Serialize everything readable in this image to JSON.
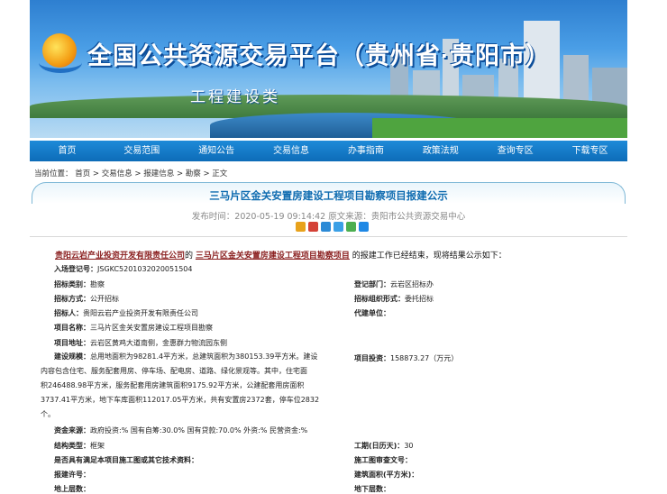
{
  "banner": {
    "title": "全国公共资源交易平台（贵州省·贵阳市）",
    "subtitle": "工程建设类"
  },
  "nav": [
    "首页",
    "交易范围",
    "通知公告",
    "交易信息",
    "办事指南",
    "政策法规",
    "查询专区",
    "下载专区"
  ],
  "breadcrumb": "当前位置： 首页 > 交易信息 > 报建信息 > 勘察 > 正文",
  "article": {
    "title": "三马片区金关安置房建设工程项目勘察项目报建公示",
    "meta": "发布时间：2020-05-19 09:14:42  原文来源：贵阳市公共资源交易中心",
    "intro_org": "贵阳云岩产业投资开发有限责任公司",
    "intro_mid": "的",
    "intro_project": "三马片区金关安置房建设工程项目勘察项目",
    "intro_tail": "的报建工作已经结束，现将结果公示如下："
  },
  "share_colors": [
    "#e8a21b",
    "#d44136",
    "#2b8ad6",
    "#3aa0e6",
    "#4caf50",
    "#1e88e5"
  ],
  "fields": {
    "reg_no_k": "入场登记号：",
    "reg_no_v": "JSGKC5201032020051504",
    "type_k": "招标类别：",
    "type_v": "勘察",
    "dept_k": "登记部门：",
    "dept_v": "云岩区招标办",
    "mode_k": "招标方式：",
    "mode_v": "公开招标",
    "org_form_k": "招标组织形式：",
    "org_form_v": "委托招标",
    "tenderer_k": "招标人：",
    "tenderer_v": "贵阳云岩产业投资开发有限责任公司",
    "agent_k": "代建单位：",
    "agent_v": "",
    "proj_name_k": "项目名称：",
    "proj_name_v": "三马片区金关安置房建设工程项目勘察",
    "proj_addr_k": "项目地址：",
    "proj_addr_v": "云岩区黄鸡大道南侧，金惠群力物流园东侧",
    "scale_k": "建设规模：",
    "scale_v": "总用地面积为98281.4平方米，总建筑面积为380153.39平方米。建设内容包含住宅、服务配套用房、停车场、配电房、道路、绿化景观等。其中，住宅面积246488.98平方米，服务配套用房建筑面积9175.92平方米，公建配套用房面积3737.41平方米，地下车库面积112017.05平方米，共有安置房2372套，停车位2832个。",
    "scale_l1": "总用地面积为98281.4平方米，总建筑面积为380153.39平方米。建设",
    "scale_l2": "内容包含住宅、服务配套用房、停车场、配电房、道路、绿化景观等。其中，住宅面",
    "scale_l3": "积246488.98平方米，服务配套用房建筑面积9175.92平方米，公建配套用房面积",
    "scale_l4": "3737.41平方米，地下车库面积112017.05平方米，共有安置房2372套，停车位2832",
    "scale_l5": "个。",
    "invest_k": "项目投资：",
    "invest_v": "158873.27（万元）",
    "fund_k": "资金来源：",
    "fund_v": "政府投资:%  国有自筹:30.0%  国有贷款:70.0%  外资:%  民营资金:%",
    "struct_k": "结构类型：",
    "struct_v": "框架",
    "period_k": "工期(日历天)：",
    "period_v": "30",
    "drawings_k": "是否具有满足本项目施工图或其它技术资料：",
    "drawings_v": "",
    "review_k": "施工图审查文号：",
    "review_v": "",
    "permit_k": "报建许号：",
    "permit_v": "",
    "area_k": "建筑面积(平方米)：",
    "area_v": "",
    "floors_up_k": "地上层数：",
    "floors_up_v": "",
    "floors_down_k": "地下层数：",
    "floors_down_v": ""
  }
}
